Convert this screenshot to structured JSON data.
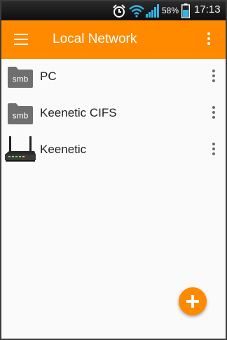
{
  "status_bar": {
    "icons": [
      "alarm-icon",
      "wifi-icon",
      "signal-icon",
      "battery-icon"
    ],
    "battery_percent": "58%",
    "time": "17:13"
  },
  "app_bar": {
    "title": "Local Network",
    "menu_icon": "hamburger-menu-icon",
    "overflow_icon": "more-vertical-icon"
  },
  "items": [
    {
      "label": "PC",
      "icon": "smb-folder-icon",
      "icon_text": "smb"
    },
    {
      "label": "Keenetic CIFS",
      "icon": "smb-folder-icon",
      "icon_text": "smb"
    },
    {
      "label": "Keenetic",
      "icon": "router-icon"
    }
  ],
  "fab": {
    "icon": "plus-icon"
  },
  "colors": {
    "accent": "#ff8a00",
    "folder": "#6f6f6f",
    "background": "#fafafa"
  }
}
